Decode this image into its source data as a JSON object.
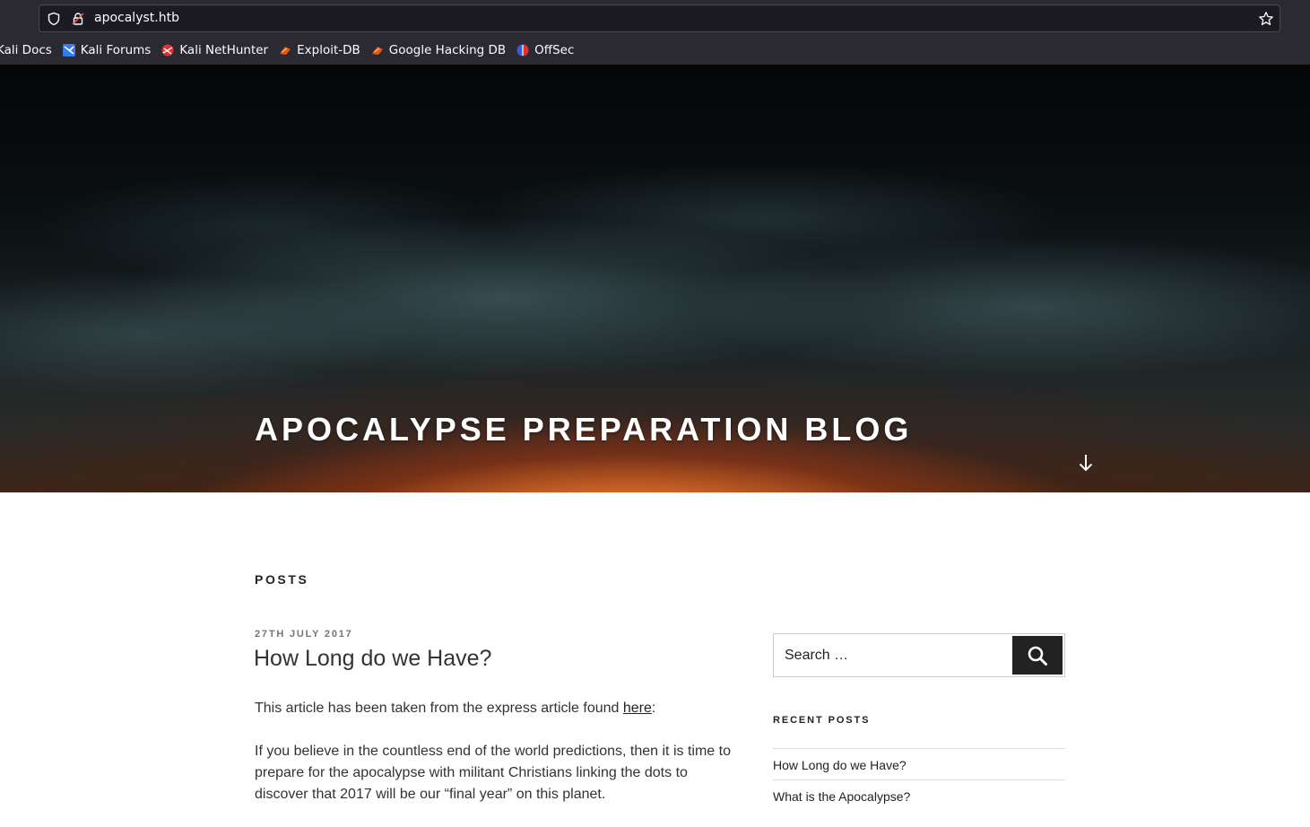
{
  "browser": {
    "url": "apocalyst.htb",
    "bookmarks": [
      {
        "label": "Kali Docs",
        "icon": "kali-docs-icon"
      },
      {
        "label": "Kali Forums",
        "icon": "kali-forums-icon"
      },
      {
        "label": "Kali NetHunter",
        "icon": "kali-nethunter-icon"
      },
      {
        "label": "Exploit-DB",
        "icon": "exploit-db-icon"
      },
      {
        "label": "Google Hacking DB",
        "icon": "ghdb-icon"
      },
      {
        "label": "OffSec",
        "icon": "offsec-icon"
      }
    ]
  },
  "hero": {
    "site_title": "APOCALYPSE PREPARATION BLOG"
  },
  "content": {
    "section_heading": "POSTS",
    "post": {
      "date": "27TH JULY 2017",
      "title": "How Long do we Have?",
      "intro_prefix": "This article has been taken from the express article found ",
      "intro_link": "here",
      "intro_suffix": ":",
      "paragraph2": "If you believe in the countless end of the world predictions, then it is time to prepare for the apocalypse with militant Christians linking the dots to discover that 2017 will be our “final year” on this planet."
    }
  },
  "sidebar": {
    "search_placeholder": "Search …",
    "search_button_label": "Search",
    "recent_heading": "RECENT POSTS",
    "recent_posts": [
      "How Long do we Have?",
      "What is the Apocalypse?"
    ]
  },
  "colors": {
    "chrome_bg": "#2b2a33",
    "urlbar_bg": "#1c1b22",
    "text": "#333333",
    "accent_dark": "#222222"
  }
}
